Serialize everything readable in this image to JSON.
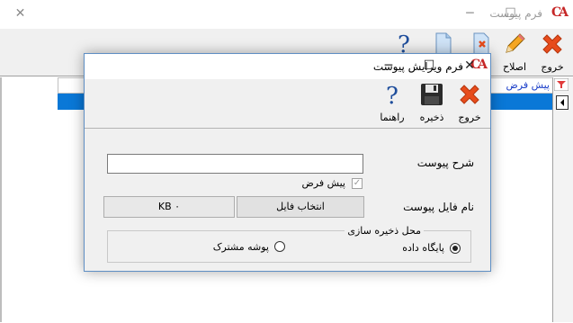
{
  "main_window": {
    "title": "فرم پیوست",
    "toolbar": [
      {
        "id": "exit",
        "label": "خروج",
        "icon": "red-x-icon"
      },
      {
        "id": "edit",
        "label": "اصلاح",
        "icon": "pencil-icon"
      },
      {
        "id": "delete",
        "label": "",
        "icon": "delete-document-icon"
      },
      {
        "id": "new",
        "label": "",
        "icon": "new-document-icon"
      },
      {
        "id": "help",
        "label": "",
        "icon": "help-icon"
      }
    ],
    "grid_header": "پیش فرض"
  },
  "dialog": {
    "title": "فرم ویرایش پیوست",
    "toolbar": {
      "exit_label": "خروج",
      "save_label": "ذخیره",
      "help_label": "راهنما"
    },
    "description_label": "شرح پیوست",
    "description_value": "",
    "default_checkbox_label": "پیش فرض",
    "default_checked": true,
    "file_name_label": "نام فایل پیوست",
    "select_file_button": "انتخاب فایل",
    "file_size_display": "KB ۰",
    "storage_group_label": "محل ذخیره سازی",
    "storage_options": [
      {
        "label": "پایگاه داده",
        "selected": true
      },
      {
        "label": "پوشه مشترک",
        "selected": false
      }
    ]
  },
  "colors": {
    "accent_red": "#e74c1c",
    "selection_blue": "#0a78d7",
    "logo_red": "#c62828"
  }
}
